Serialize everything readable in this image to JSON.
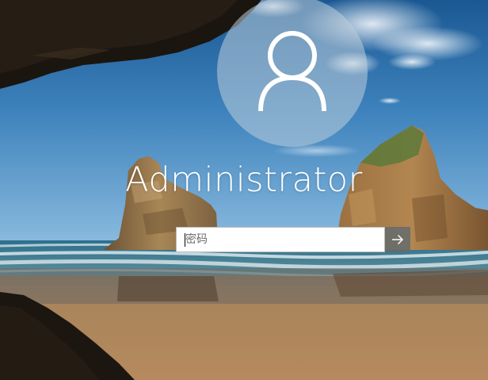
{
  "user": {
    "name": "Administrator"
  },
  "password": {
    "placeholder": "密码",
    "value": ""
  },
  "icons": {
    "avatar": "user-silhouette-icon",
    "submit": "arrow-right-icon"
  },
  "colors": {
    "sky_top": "#1a5a94",
    "sky_bottom": "#7bb1dc",
    "sand": "#b68a5e",
    "rock": "#8f6a3e",
    "submit_bg": "#5f676b"
  }
}
